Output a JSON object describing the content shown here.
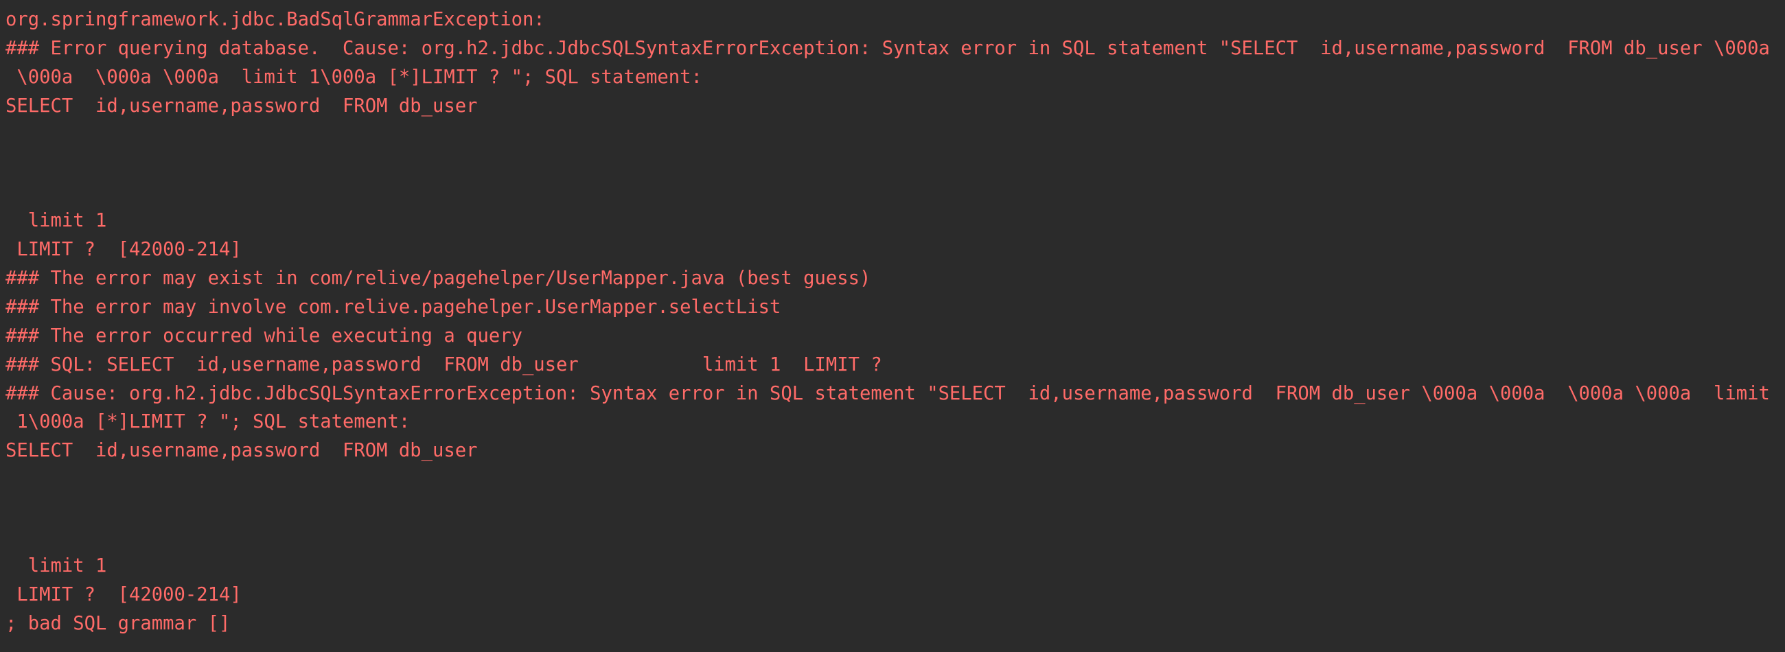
{
  "console": {
    "text_color": "#ff6b68",
    "background": "#2b2b2b",
    "lines": [
      "org.springframework.jdbc.BadSqlGrammarException:",
      "### Error querying database.  Cause: org.h2.jdbc.JdbcSQLSyntaxErrorException: Syntax error in SQL statement \"SELECT  id,username,password  FROM db_user \\000a",
      " \\000a  \\000a \\000a  limit 1\\000a [*]LIMIT ? \"; SQL statement:",
      "SELECT  id,username,password  FROM db_user",
      "",
      "",
      "",
      "  limit 1",
      " LIMIT ?  [42000-214]",
      "### The error may exist in com/relive/pagehelper/UserMapper.java (best guess)",
      "### The error may involve com.relive.pagehelper.UserMapper.selectList",
      "### The error occurred while executing a query",
      "### SQL: SELECT  id,username,password  FROM db_user           limit 1  LIMIT ?",
      "### Cause: org.h2.jdbc.JdbcSQLSyntaxErrorException: Syntax error in SQL statement \"SELECT  id,username,password  FROM db_user \\000a \\000a  \\000a \\000a  limit",
      " 1\\000a [*]LIMIT ? \"; SQL statement:",
      "SELECT  id,username,password  FROM db_user",
      "",
      "",
      "",
      "  limit 1",
      " LIMIT ?  [42000-214]",
      "; bad SQL grammar []"
    ]
  }
}
